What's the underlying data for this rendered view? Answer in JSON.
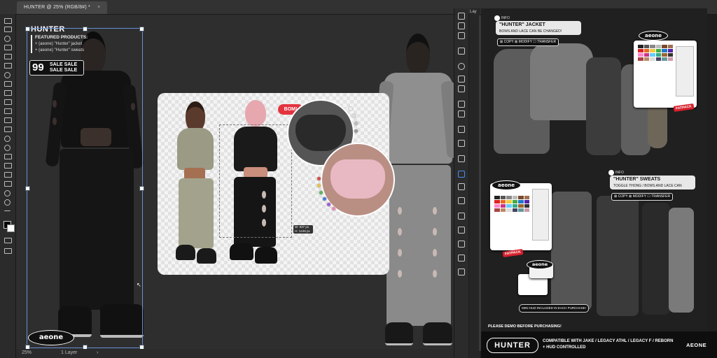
{
  "app": {
    "document_tab": "HUNTER @ 25% (RGB/8#) *",
    "tab_close": "×",
    "layers_panel_label": "Lay",
    "status": {
      "zoom": "25%",
      "layers": "1 Layer",
      "chevron": "›"
    }
  },
  "colors": {
    "canvas_bg": "#2e2e2e",
    "selection": "#6a8fd8",
    "bom_red": "#e2333f",
    "fatpack_red": "#d61f2c"
  },
  "poster": {
    "title": "HUNTER",
    "featured_heading": "FEATURED PRODUCTS:",
    "featured_items": [
      "+  (aeone) \"Hunter\" jacket",
      "+  (aeone) \"Hunter\" sweats"
    ],
    "sale": {
      "number": "99",
      "line1": "SALE SALE",
      "line2": "SALE SALE"
    },
    "logo": "aeone"
  },
  "card": {
    "bom_badge": "BOM!",
    "size_tip_w": "W:  837 px",
    "size_tip_h": "H:  1448 px"
  },
  "promo": {
    "jacket": {
      "info_label": "INFO",
      "title": "\"HUNTER\" JACKET",
      "subtitle": "BOWS AND LACE CAN BE CHANGED!",
      "perms": [
        "⊠ COPY  ⊠ MODIFY  ☐ TRANSFER"
      ]
    },
    "sweats": {
      "info_label": "INFO",
      "title": "\"HUNTER\" SWEATS",
      "subtitle": "TOGGLE THONG / BOWS AND LACE CAN",
      "perms": [
        "⊠ COPY  ⊠ MODIFY  ☐ TRANSFER"
      ]
    },
    "fatpack_label": "FATPACK",
    "logo": "aeone",
    "minihud_note": "MINI HUD INCLUDED IN EACH PURCHASE!",
    "demo_note": "PLEASE DEMO BEFORE PURCHASING!",
    "footer": {
      "name": "HUNTER",
      "compat_line1": "COMPATIBLE WITH JAKE / LEGACY ATHL / LEGACY F / REBORN",
      "compat_line2": "+ HUD CONTROLLED",
      "brand": "AEONE"
    }
  }
}
